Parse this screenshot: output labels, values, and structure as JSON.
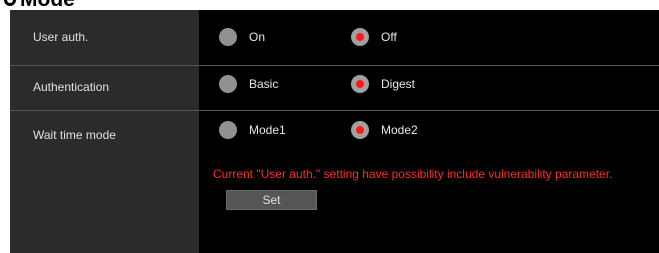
{
  "section": {
    "title": "Mode"
  },
  "rows": [
    {
      "label": "User auth.",
      "options": [
        {
          "label": "On",
          "checked": false
        },
        {
          "label": "Off",
          "checked": true
        }
      ]
    },
    {
      "label": "Authentication",
      "options": [
        {
          "label": "Basic",
          "checked": false
        },
        {
          "label": "Digest",
          "checked": true
        }
      ]
    },
    {
      "label": "Wait time mode",
      "options": [
        {
          "label": "Mode1",
          "checked": false
        },
        {
          "label": "Mode2",
          "checked": true
        }
      ]
    }
  ],
  "warning": "Current \"User auth.\" setting have possibility include vulnerability parameter.",
  "set_button": {
    "label": "Set"
  },
  "colors": {
    "warning": "#ff2a2a",
    "radio_selected_dot": "#ff1a1a",
    "panel_label_bg": "#2b2b2b",
    "panel_value_bg": "#000000"
  }
}
